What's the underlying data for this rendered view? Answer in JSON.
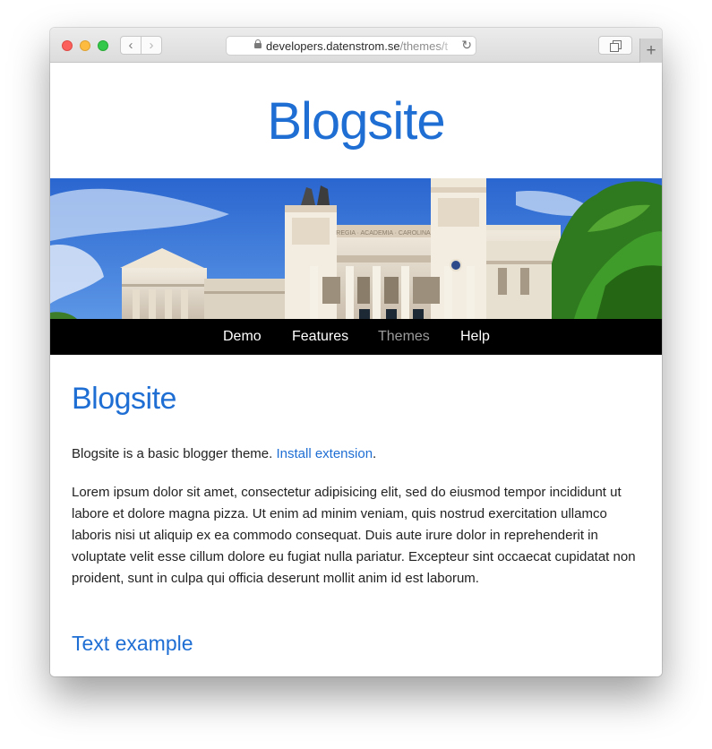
{
  "browser": {
    "url_main": "developers.datenstrom.se",
    "url_faded": "/themes/t",
    "back_label": "‹",
    "forward_label": "›",
    "reload_label": "↻",
    "new_tab_label": "+"
  },
  "site": {
    "title": "Blogsite",
    "menu": [
      {
        "label": "Demo",
        "active": false
      },
      {
        "label": "Features",
        "active": false
      },
      {
        "label": "Themes",
        "active": true
      },
      {
        "label": "Help",
        "active": false
      }
    ]
  },
  "content": {
    "title": "Blogsite",
    "intro_text": "Blogsite is a basic blogger theme. ",
    "intro_link": "Install extension",
    "intro_end": ".",
    "lorem": "Lorem ipsum dolor sit amet, consectetur adipisicing elit, sed do eiusmod tempor incididunt ut labore et dolore magna pizza. Ut enim ad minim veniam, quis nostrud exercitation ullamco laboris nisi ut aliquip ex ea commodo consequat. Duis aute irure dolor in reprehenderit in voluptate velit esse cillum dolore eu fugiat nulla pariatur. Excepteur sint occaecat cupidatat non proident, sunt in culpa qui officia deserunt mollit anim id est laborum.",
    "subheading": "Text example",
    "hero_inscription": "REGIA · ACADEMIA · CAROLINA"
  },
  "colors": {
    "accent": "#1e6ed4",
    "menu_bg": "#000000",
    "menu_active": "#9b9b9b",
    "sky": "#2f6fd2",
    "foliage": "#2f7a1e"
  }
}
